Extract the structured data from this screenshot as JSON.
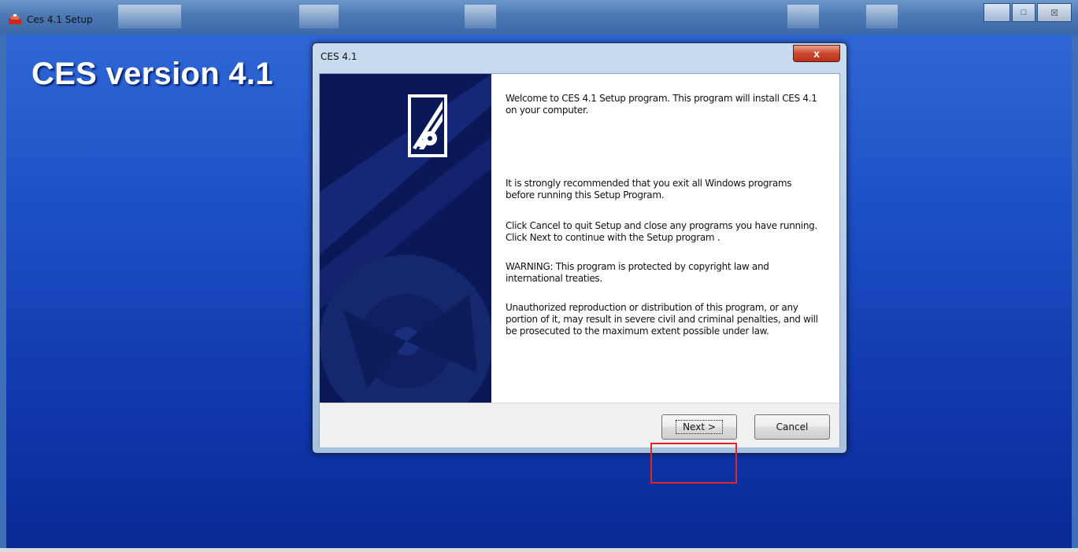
{
  "app_window": {
    "title": "Ces 4.1 Setup",
    "controls": {
      "minimize": "",
      "maximize": "□",
      "close": "☒"
    }
  },
  "heading": "CES version 4.1",
  "dialog": {
    "title": "CES 4.1",
    "close_glyph": "x",
    "paragraphs": [
      "Welcome to CES 4.1 Setup program. This program will install CES 4.1 on your computer.",
      "It is strongly recommended that you exit all Windows programs before running this Setup Program.",
      "Click Cancel to quit Setup and close any programs you have running.  Click Next to continue with the Setup program .",
      "WARNING: This program is protected by copyright law and international treaties.",
      "Unauthorized reproduction or distribution of this program, or any portion of it, may result in severe civil and criminal penalties, and will be prosecuted to the maximum extent possible under law."
    ],
    "buttons": {
      "next": "Next >",
      "cancel": "Cancel"
    }
  },
  "colors": {
    "highlight": "#e0262a",
    "banner": "#0c1a5c",
    "desktop_blue": "#1d4fc4"
  }
}
